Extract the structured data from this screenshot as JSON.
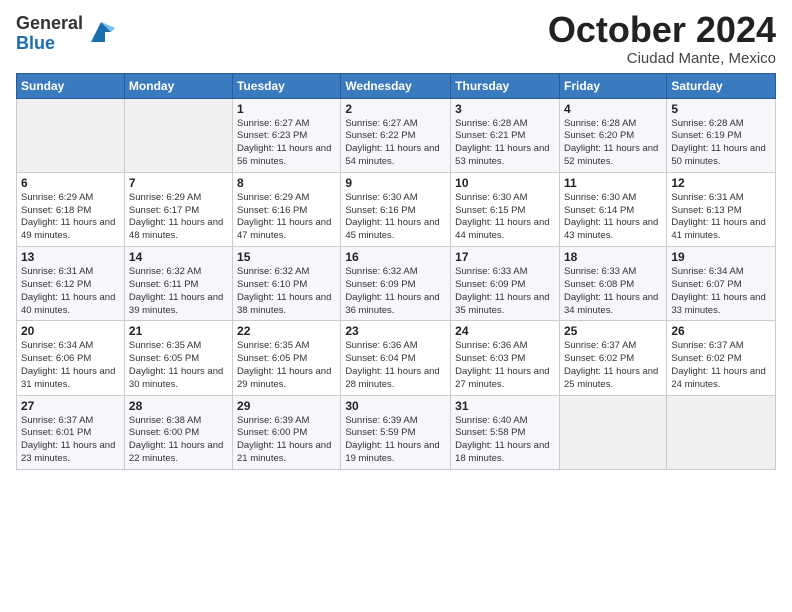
{
  "header": {
    "logo": {
      "line1": "General",
      "line2": "Blue"
    },
    "month": "October 2024",
    "location": "Ciudad Mante, Mexico"
  },
  "weekdays": [
    "Sunday",
    "Monday",
    "Tuesday",
    "Wednesday",
    "Thursday",
    "Friday",
    "Saturday"
  ],
  "weeks": [
    [
      {
        "day": "",
        "info": ""
      },
      {
        "day": "",
        "info": ""
      },
      {
        "day": "1",
        "info": "Sunrise: 6:27 AM\nSunset: 6:23 PM\nDaylight: 11 hours and 56 minutes."
      },
      {
        "day": "2",
        "info": "Sunrise: 6:27 AM\nSunset: 6:22 PM\nDaylight: 11 hours and 54 minutes."
      },
      {
        "day": "3",
        "info": "Sunrise: 6:28 AM\nSunset: 6:21 PM\nDaylight: 11 hours and 53 minutes."
      },
      {
        "day": "4",
        "info": "Sunrise: 6:28 AM\nSunset: 6:20 PM\nDaylight: 11 hours and 52 minutes."
      },
      {
        "day": "5",
        "info": "Sunrise: 6:28 AM\nSunset: 6:19 PM\nDaylight: 11 hours and 50 minutes."
      }
    ],
    [
      {
        "day": "6",
        "info": "Sunrise: 6:29 AM\nSunset: 6:18 PM\nDaylight: 11 hours and 49 minutes."
      },
      {
        "day": "7",
        "info": "Sunrise: 6:29 AM\nSunset: 6:17 PM\nDaylight: 11 hours and 48 minutes."
      },
      {
        "day": "8",
        "info": "Sunrise: 6:29 AM\nSunset: 6:16 PM\nDaylight: 11 hours and 47 minutes."
      },
      {
        "day": "9",
        "info": "Sunrise: 6:30 AM\nSunset: 6:16 PM\nDaylight: 11 hours and 45 minutes."
      },
      {
        "day": "10",
        "info": "Sunrise: 6:30 AM\nSunset: 6:15 PM\nDaylight: 11 hours and 44 minutes."
      },
      {
        "day": "11",
        "info": "Sunrise: 6:30 AM\nSunset: 6:14 PM\nDaylight: 11 hours and 43 minutes."
      },
      {
        "day": "12",
        "info": "Sunrise: 6:31 AM\nSunset: 6:13 PM\nDaylight: 11 hours and 41 minutes."
      }
    ],
    [
      {
        "day": "13",
        "info": "Sunrise: 6:31 AM\nSunset: 6:12 PM\nDaylight: 11 hours and 40 minutes."
      },
      {
        "day": "14",
        "info": "Sunrise: 6:32 AM\nSunset: 6:11 PM\nDaylight: 11 hours and 39 minutes."
      },
      {
        "day": "15",
        "info": "Sunrise: 6:32 AM\nSunset: 6:10 PM\nDaylight: 11 hours and 38 minutes."
      },
      {
        "day": "16",
        "info": "Sunrise: 6:32 AM\nSunset: 6:09 PM\nDaylight: 11 hours and 36 minutes."
      },
      {
        "day": "17",
        "info": "Sunrise: 6:33 AM\nSunset: 6:09 PM\nDaylight: 11 hours and 35 minutes."
      },
      {
        "day": "18",
        "info": "Sunrise: 6:33 AM\nSunset: 6:08 PM\nDaylight: 11 hours and 34 minutes."
      },
      {
        "day": "19",
        "info": "Sunrise: 6:34 AM\nSunset: 6:07 PM\nDaylight: 11 hours and 33 minutes."
      }
    ],
    [
      {
        "day": "20",
        "info": "Sunrise: 6:34 AM\nSunset: 6:06 PM\nDaylight: 11 hours and 31 minutes."
      },
      {
        "day": "21",
        "info": "Sunrise: 6:35 AM\nSunset: 6:05 PM\nDaylight: 11 hours and 30 minutes."
      },
      {
        "day": "22",
        "info": "Sunrise: 6:35 AM\nSunset: 6:05 PM\nDaylight: 11 hours and 29 minutes."
      },
      {
        "day": "23",
        "info": "Sunrise: 6:36 AM\nSunset: 6:04 PM\nDaylight: 11 hours and 28 minutes."
      },
      {
        "day": "24",
        "info": "Sunrise: 6:36 AM\nSunset: 6:03 PM\nDaylight: 11 hours and 27 minutes."
      },
      {
        "day": "25",
        "info": "Sunrise: 6:37 AM\nSunset: 6:02 PM\nDaylight: 11 hours and 25 minutes."
      },
      {
        "day": "26",
        "info": "Sunrise: 6:37 AM\nSunset: 6:02 PM\nDaylight: 11 hours and 24 minutes."
      }
    ],
    [
      {
        "day": "27",
        "info": "Sunrise: 6:37 AM\nSunset: 6:01 PM\nDaylight: 11 hours and 23 minutes."
      },
      {
        "day": "28",
        "info": "Sunrise: 6:38 AM\nSunset: 6:00 PM\nDaylight: 11 hours and 22 minutes."
      },
      {
        "day": "29",
        "info": "Sunrise: 6:39 AM\nSunset: 6:00 PM\nDaylight: 11 hours and 21 minutes."
      },
      {
        "day": "30",
        "info": "Sunrise: 6:39 AM\nSunset: 5:59 PM\nDaylight: 11 hours and 19 minutes."
      },
      {
        "day": "31",
        "info": "Sunrise: 6:40 AM\nSunset: 5:58 PM\nDaylight: 11 hours and 18 minutes."
      },
      {
        "day": "",
        "info": ""
      },
      {
        "day": "",
        "info": ""
      }
    ]
  ]
}
